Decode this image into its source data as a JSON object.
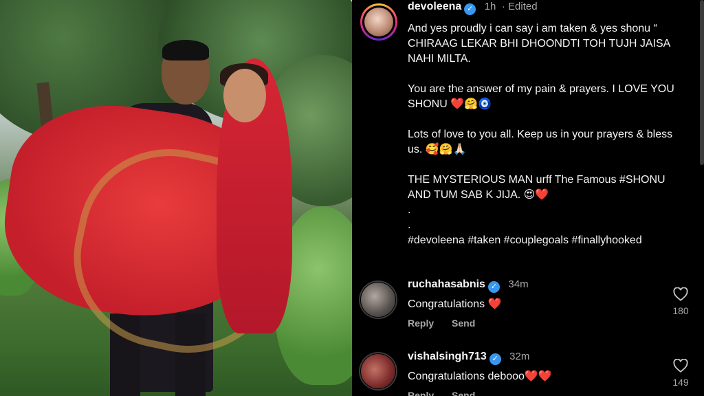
{
  "post": {
    "username": "devoleena",
    "time": "1h",
    "edited": "· Edited",
    "caption_lines": [
      "And yes proudly i can say i am taken & yes shonu “ CHIRAAG LEKAR BHI DHOONDTI TOH TUJH JAISA NAHI MILTA.",
      "",
      "You are the answer of my pain & prayers. I LOVE YOU SHONU ❤️🤗🧿",
      "",
      "Lots of love to you all. Keep us in your prayers & bless us. 🥰🤗🙏🏻",
      "",
      "THE MYSTERIOUS MAN urff The Famous #SHONU AND TUM SAB K JIJA. 😍❤️",
      ".",
      ".",
      "#devoleena #taken #couplegoals #finallyhooked"
    ]
  },
  "comments": [
    {
      "username": "ruchahasabnis",
      "time": "34m",
      "text": "Congratulations ❤️",
      "reply": "Reply",
      "send": "Send",
      "likes": "180"
    },
    {
      "username": "vishalsingh713",
      "time": "32m",
      "text": "Congratulations debooo❤️❤️",
      "reply": "Reply",
      "send": "Send",
      "likes": "149"
    }
  ],
  "icons": {
    "verified": "verified-badge-icon",
    "like": "heart-outline-icon"
  },
  "colors": {
    "background": "#000000",
    "verified": "#3897f0",
    "muted": "#a8a8a8"
  }
}
